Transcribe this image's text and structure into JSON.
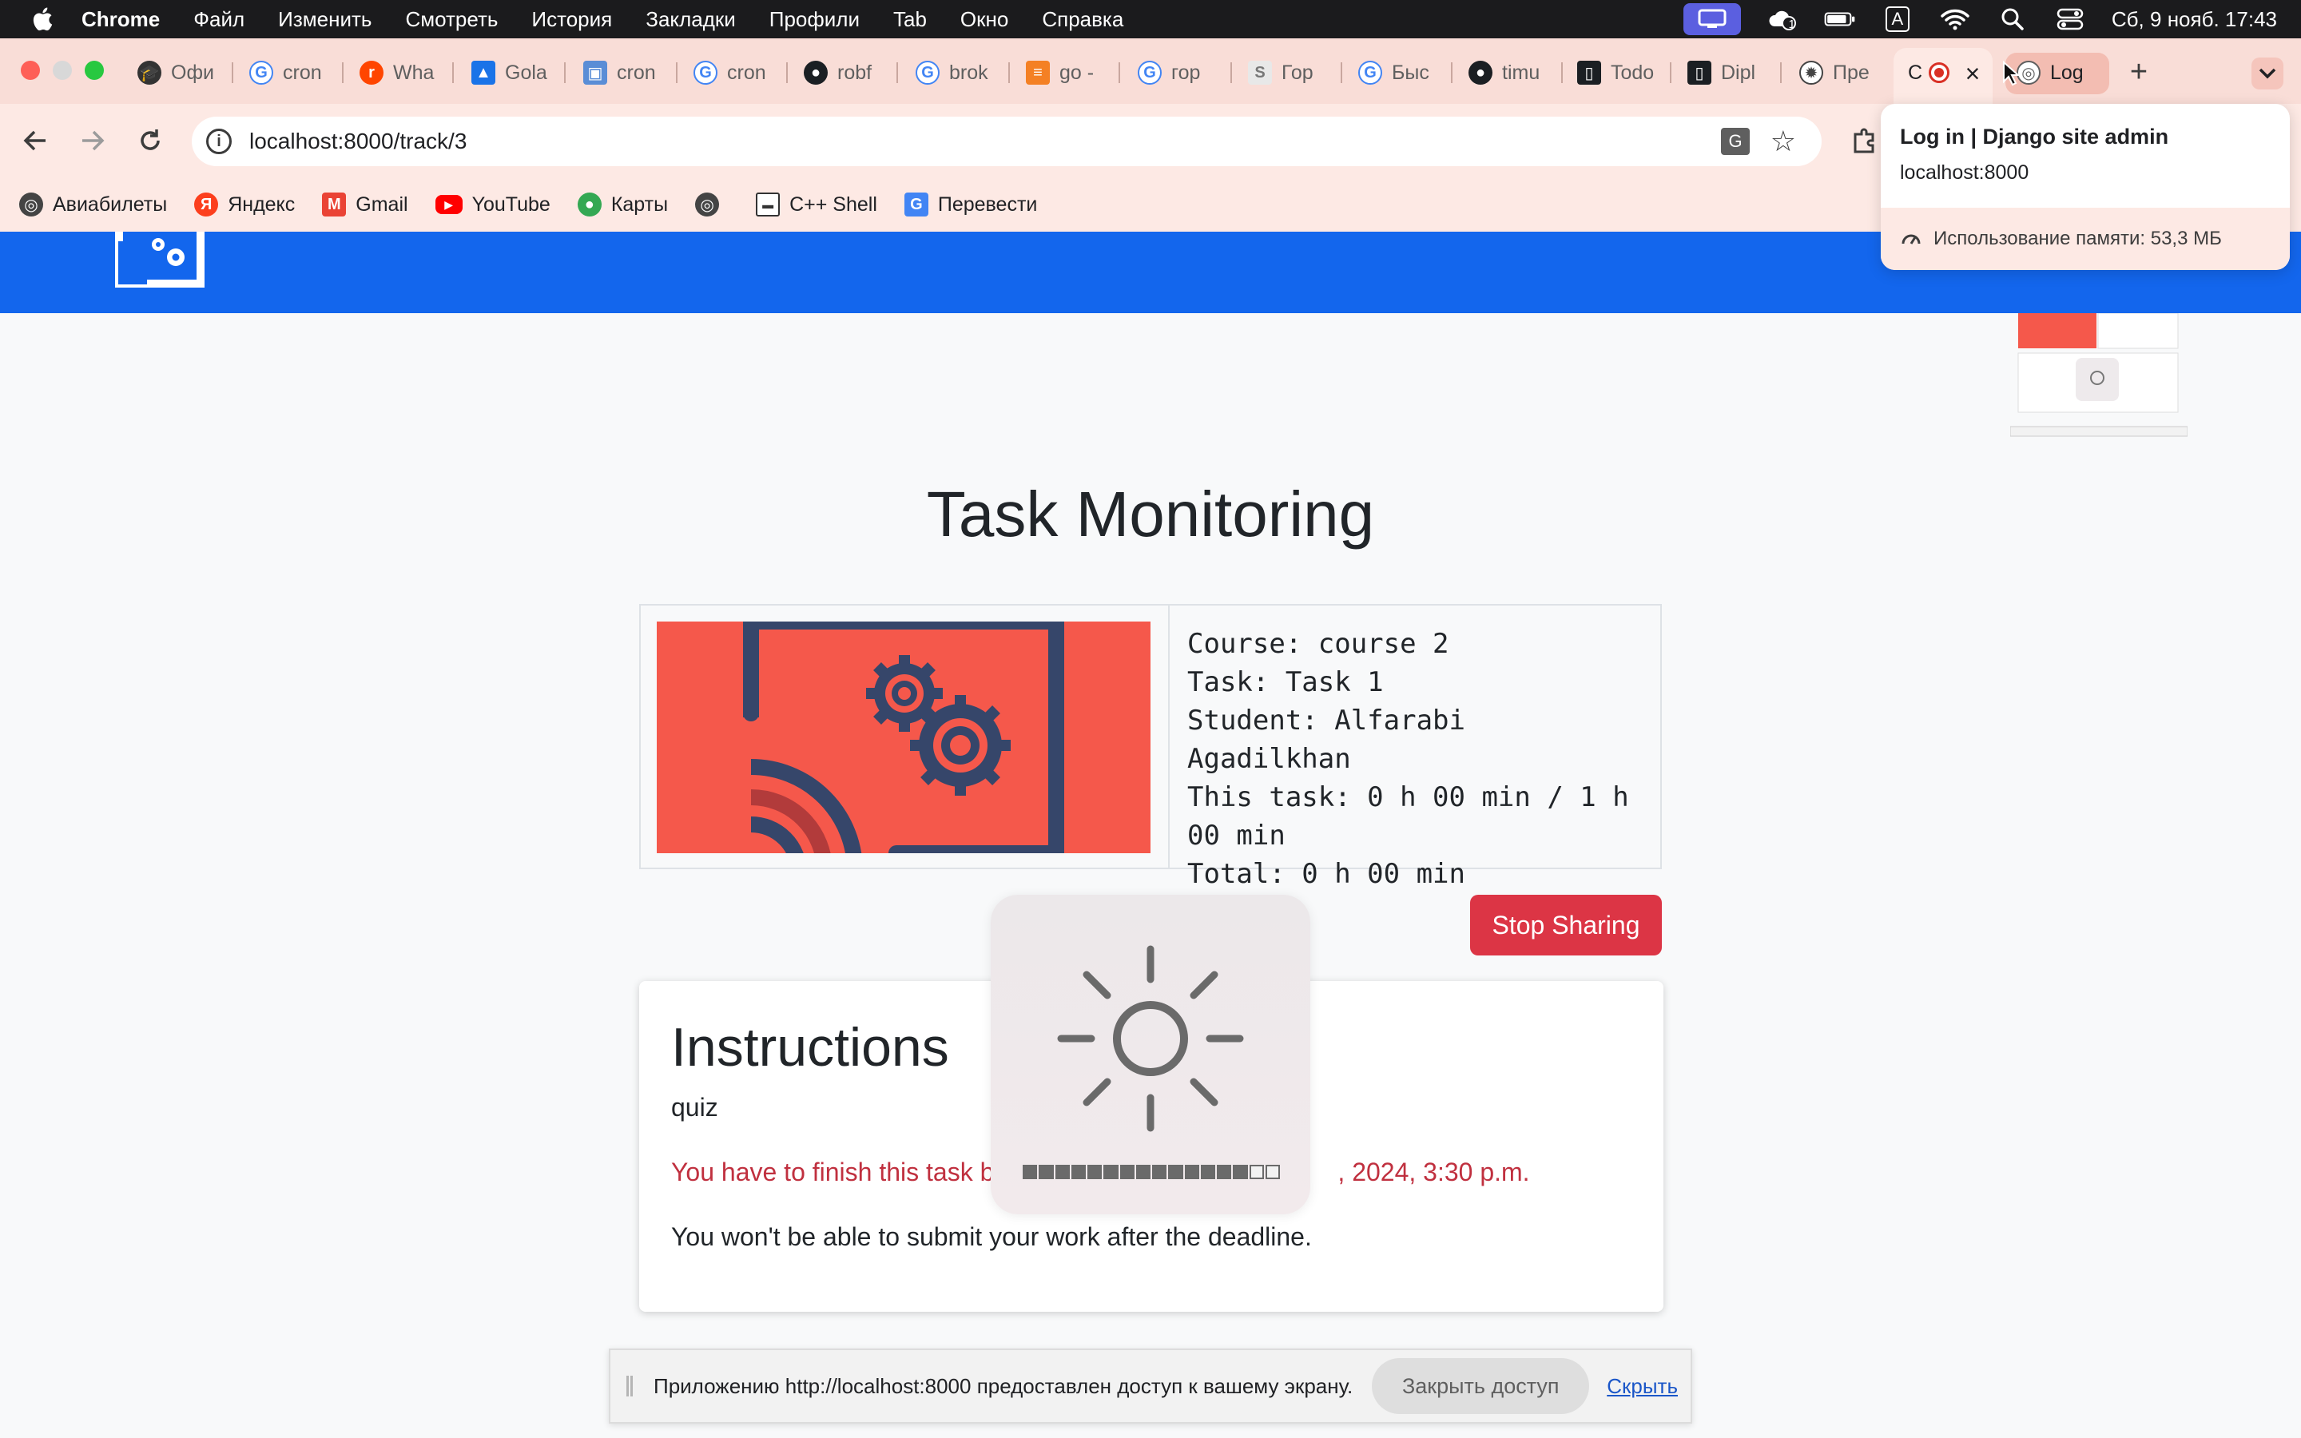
{
  "menubar": {
    "app": "Chrome",
    "items": [
      "Файл",
      "Изменить",
      "Смотреть",
      "История",
      "Закладки",
      "Профили",
      "Tab",
      "Окно",
      "Справка"
    ],
    "clock": "Сб, 9 нояб. 17:43",
    "input_source": "A",
    "notification_count": "1"
  },
  "tabs": [
    {
      "label": "Офи",
      "icon": "graduation-cap-icon",
      "color": "#333333"
    },
    {
      "label": "cron",
      "icon": "google-icon",
      "color": "#4285f4"
    },
    {
      "label": "Wha",
      "icon": "reddit-icon",
      "color": "#ff4500"
    },
    {
      "label": "Gola",
      "icon": "chart-icon",
      "color": "#1a73e8"
    },
    {
      "label": "cron",
      "icon": "gopher-icon",
      "color": "#5a8dd6"
    },
    {
      "label": "cron",
      "icon": "google-icon",
      "color": "#4285f4"
    },
    {
      "label": "robf",
      "icon": "github-icon",
      "color": "#1b1f23"
    },
    {
      "label": "brok",
      "icon": "google-icon",
      "color": "#4285f4"
    },
    {
      "label": "go -",
      "icon": "stackoverflow-icon",
      "color": "#f48024"
    },
    {
      "label": "гор",
      "icon": "google-icon",
      "color": "#4285f4"
    },
    {
      "label": "Гор",
      "icon": "page-icon",
      "color": "#cfcfcf"
    },
    {
      "label": "Быс",
      "icon": "google-icon",
      "color": "#4285f4"
    },
    {
      "label": "timu",
      "icon": "github-icon",
      "color": "#1b1f23"
    },
    {
      "label": "Todo",
      "icon": "trello-icon",
      "color": "#1b1f23"
    },
    {
      "label": "Dipl",
      "icon": "trello-icon",
      "color": "#1b1f23"
    },
    {
      "label": "Пре",
      "icon": "openai-icon",
      "color": "#444444"
    },
    {
      "label": "С",
      "icon": "recording-icon",
      "color": "#d93025"
    },
    {
      "label": "Log",
      "icon": "globe-icon",
      "color": "#5f5f5f"
    }
  ],
  "address": {
    "url": "localhost:8000/track/3"
  },
  "bookmarks": [
    {
      "label": "Авиабилеты",
      "icon": "globe-icon",
      "color": "#444444"
    },
    {
      "label": "Яндекс",
      "icon": "yandex-icon",
      "color": "#fc3f1d"
    },
    {
      "label": "Gmail",
      "icon": "gmail-icon",
      "color": "#ea4335"
    },
    {
      "label": "YouTube",
      "icon": "youtube-icon",
      "color": "#ff0000"
    },
    {
      "label": "Карты",
      "icon": "maps-icon",
      "color": "#34a853"
    },
    {
      "label": "",
      "icon": "globe-icon",
      "color": "#444444"
    },
    {
      "label": "C++ Shell",
      "icon": "terminal-icon",
      "color": "#333333"
    },
    {
      "label": "Перевести",
      "icon": "translate-icon",
      "color": "#4285f4"
    }
  ],
  "hovercard": {
    "title": "Log in | Django site admin",
    "subtitle": "localhost:8000",
    "memory": "Использование памяти: 53,3 МБ"
  },
  "page": {
    "title": "Task Monitoring",
    "info": {
      "course": "Course: course 2",
      "task": "Task: Task 1",
      "student": "Student: Alfarabi Agadilkhan",
      "this_task_1": "This task: 0 h 00 min / 1 h",
      "this_task_2": "00 min",
      "total": "Total: 0 h 00 min"
    },
    "stop_button": "Stop Sharing",
    "instructions": {
      "title": "Instructions",
      "text": "quiz",
      "deadline_start": "You have to finish this task b",
      "deadline_end": ", 2024, 3:30 p.m.",
      "note": "You won't be able to submit your work after the deadline."
    }
  },
  "osd": {
    "brightness_level": 0.88
  },
  "share_bar": {
    "message": "Приложению http://localhost:8000 предоставлен доступ к вашему экрану.",
    "close_button": "Закрыть доступ",
    "hide_link": "Скрыть"
  },
  "colors": {
    "header_blue": "#1366ed",
    "danger": "#dc3545",
    "tab_strip": "#f9ddd7",
    "thumb_red": "#f5584b"
  }
}
